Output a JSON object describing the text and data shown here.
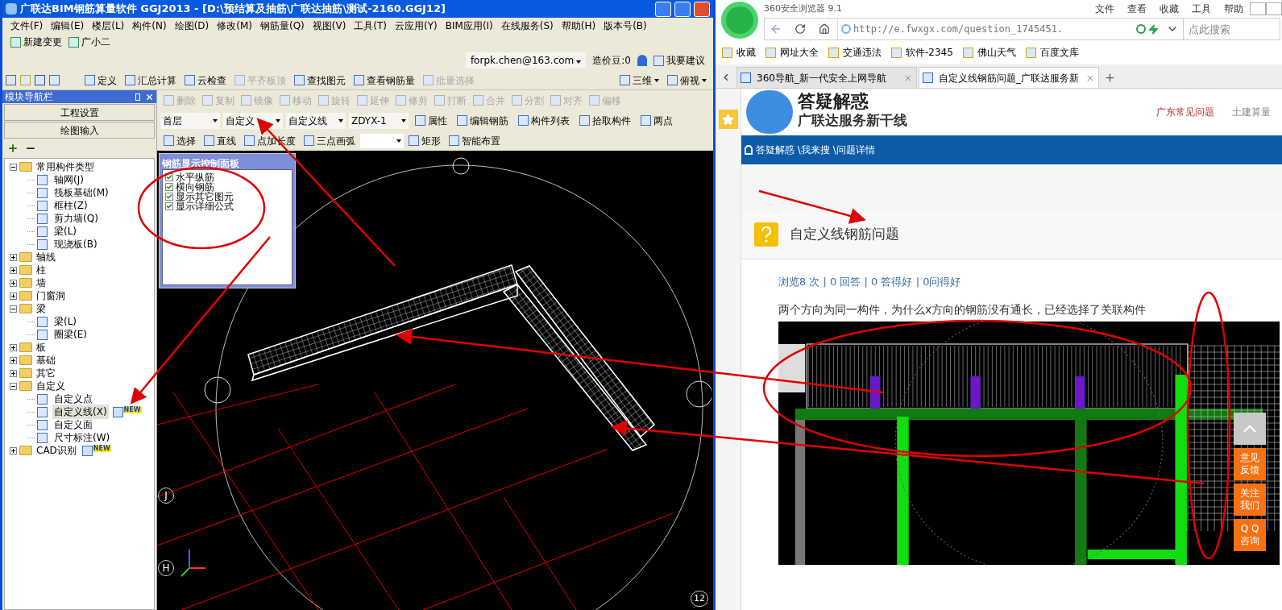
{
  "cad_window": {
    "title": "广联达BIM钢筋算量软件 GGJ2013 - [D:\\预结算及抽筋\\广联达抽筋\\测试-2160.GGJ12]",
    "menu": [
      "文件(F)",
      "编辑(E)",
      "楼层(L)",
      "构件(N)",
      "绘图(D)",
      "修改(M)",
      "钢筋量(Q)",
      "视图(V)",
      "工具(T)",
      "云应用(Y)",
      "BIM应用(I)",
      "在线服务(S)",
      "帮助(H)",
      "版本号(B)"
    ],
    "quick": [
      "新建变更",
      "广小二"
    ],
    "account": {
      "email": "forpk.chen@163.com",
      "coins": "造价豆:0",
      "suggest": "我要建议"
    },
    "toolbar": [
      {
        "label": "定义",
        "disabled": false
      },
      {
        "label": "汇总计算",
        "disabled": false
      },
      {
        "label": "云检查",
        "disabled": false
      },
      {
        "label": "平齐板顶",
        "disabled": true
      },
      {
        "label": "查找图元",
        "disabled": false
      },
      {
        "label": "查看钢筋量",
        "disabled": false
      },
      {
        "label": "批量选择",
        "disabled": true
      }
    ],
    "view_buttons": [
      "三维",
      "俯视"
    ],
    "nav": {
      "title": "模块导航栏",
      "buttons": [
        "工程设置",
        "绘图输入"
      ],
      "tree": [
        {
          "kind": "folder",
          "label": "常用构件类型",
          "expanded": true,
          "selected": false,
          "children": [
            {
              "kind": "item",
              "label": "轴网(J)",
              "selected": false
            },
            {
              "kind": "item",
              "label": "筏板基础(M)",
              "selected": false
            },
            {
              "kind": "item",
              "label": "框柱(Z)",
              "selected": false
            },
            {
              "kind": "item",
              "label": "剪力墙(Q)",
              "selected": false
            },
            {
              "kind": "item",
              "label": "梁(L)",
              "selected": false
            },
            {
              "kind": "item",
              "label": "现浇板(B)",
              "selected": false
            }
          ]
        },
        {
          "kind": "folder",
          "label": "轴线",
          "expanded": false,
          "selected": false
        },
        {
          "kind": "folder",
          "label": "柱",
          "expanded": false,
          "selected": false
        },
        {
          "kind": "folder",
          "label": "墙",
          "expanded": false,
          "selected": false
        },
        {
          "kind": "folder",
          "label": "门窗洞",
          "expanded": false,
          "selected": false
        },
        {
          "kind": "folder",
          "label": "梁",
          "expanded": true,
          "selected": false,
          "children": [
            {
              "kind": "item",
              "label": "梁(L)",
              "selected": false
            },
            {
              "kind": "item",
              "label": "圈梁(E)",
              "selected": false
            }
          ]
        },
        {
          "kind": "folder",
          "label": "板",
          "expanded": false,
          "selected": false
        },
        {
          "kind": "folder",
          "label": "基础",
          "expanded": false,
          "selected": false
        },
        {
          "kind": "folder",
          "label": "其它",
          "expanded": false,
          "selected": false
        },
        {
          "kind": "folder",
          "label": "自定义",
          "expanded": true,
          "selected": false,
          "children": [
            {
              "kind": "item",
              "label": "自定义点",
              "selected": false
            },
            {
              "kind": "item",
              "label": "自定义线(X)",
              "selected": true,
              "badge": "NEW"
            },
            {
              "kind": "item",
              "label": "自定义面",
              "selected": false
            },
            {
              "kind": "item",
              "label": "尺寸标注(W)",
              "selected": false
            }
          ]
        },
        {
          "kind": "folder",
          "label": "CAD识别",
          "expanded": false,
          "selected": false,
          "badge": "NEW"
        }
      ]
    },
    "edit_toolbar": [
      {
        "label": "删除",
        "disabled": true
      },
      {
        "label": "复制",
        "disabled": true
      },
      {
        "label": "镜像",
        "disabled": true
      },
      {
        "label": "移动",
        "disabled": true
      },
      {
        "label": "旋转",
        "disabled": true
      },
      {
        "label": "延伸",
        "disabled": true
      },
      {
        "label": "修剪",
        "disabled": true
      },
      {
        "label": "打断",
        "disabled": true
      },
      {
        "label": "合并",
        "disabled": true
      },
      {
        "label": "分割",
        "disabled": true
      },
      {
        "label": "对齐",
        "disabled": true
      },
      {
        "label": "偏移",
        "disabled": true
      }
    ],
    "selectors": [
      "首层",
      "自定义",
      "自定义线",
      "ZDYX-1"
    ],
    "prop_toolbar": [
      "属性",
      "编辑钢筋",
      "构件列表",
      "拾取构件",
      "两点"
    ],
    "draw_toolbar": [
      "选择",
      "直线",
      "点加长度",
      "三点画弧",
      "矩形",
      "智能布置"
    ],
    "rebar_panel": {
      "title": "钢筋显示控制面板",
      "options": [
        {
          "label": "水平纵筋",
          "checked": true
        },
        {
          "label": "横向钢筋",
          "checked": true
        },
        {
          "label": "显示其它图元",
          "checked": true
        },
        {
          "label": "显示详细公式",
          "checked": true
        }
      ]
    },
    "canvas": {
      "axis_labels": [
        "J",
        "H"
      ],
      "corner_label": "12"
    }
  },
  "browser": {
    "title": "360安全浏览器 9.1",
    "menu": [
      "文件",
      "查看",
      "收藏",
      "工具",
      "帮助"
    ],
    "url": "http://e.fwxgx.com/question_1745451.",
    "search_placeholder": "点此搜索",
    "bookmarks": [
      "收藏",
      "网址大全",
      "交通违法",
      "软件-2345",
      "佛山天气",
      "百度文库"
    ],
    "tabs": [
      {
        "label": "360导航_新一代安全上网导航",
        "selected": false
      },
      {
        "label": "自定义线钢筋问题_广联达服务新",
        "selected": true
      }
    ],
    "page": {
      "site_title": "答疑解惑",
      "site_subtitle": "广联达服务新干线",
      "links": [
        {
          "label": "广东常见问题",
          "selected": true
        },
        {
          "label": "土建算量",
          "selected": false
        }
      ],
      "breadcrumb": "答疑解惑 \\我来搜 \\问题详情",
      "question": {
        "title": "自定义线钢筋问题",
        "stats": "浏览8 次 | 0 回答 | 0 答得好 | 0问得好",
        "body": "两个方向为同一构件，为什么x方向的钢筋没有通长，已经选择了关联构件"
      },
      "float_buttons": [
        [
          "意见",
          "反馈"
        ],
        [
          "关注",
          "我们"
        ],
        [
          "Q Q",
          "咨询"
        ]
      ]
    }
  }
}
